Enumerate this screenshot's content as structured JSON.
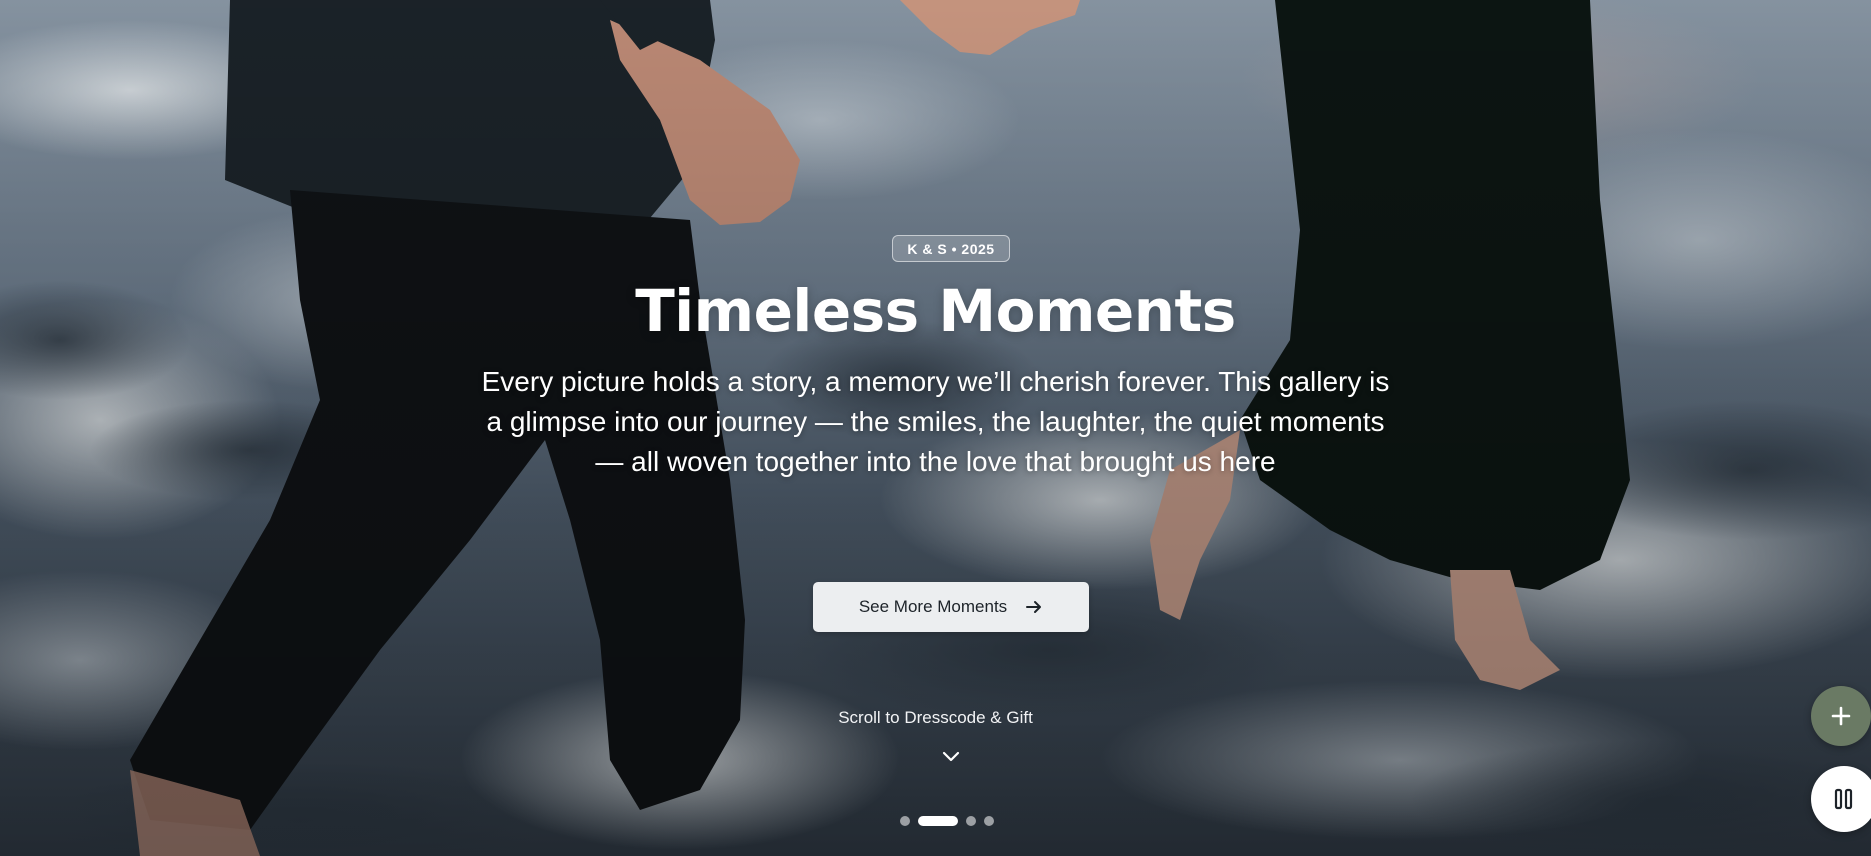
{
  "hero": {
    "badge": "K & S • 2025",
    "title": "Timeless Moments",
    "subtitle": "Every picture holds a story, a memory we’ll cherish forever. This gallery is a glimpse into our journey — the smiles, the laughter, the quiet moments — all woven together into the love that brought us here",
    "cta_label": "See More Moments",
    "cta_icon": "arrow-right-icon",
    "scroll_hint": "Scroll to Dresscode & Gift",
    "scroll_icon": "chevron-down-icon"
  },
  "carousel": {
    "slide_count": 4,
    "active_index": 1
  },
  "floating_buttons": {
    "add_icon": "plus-icon",
    "music_icon": "pause-icon"
  },
  "colors": {
    "cta_background": "#eceef0",
    "cta_text": "#1d2329",
    "add_button": "#6a7a64",
    "pause_button": "#ffffff"
  }
}
